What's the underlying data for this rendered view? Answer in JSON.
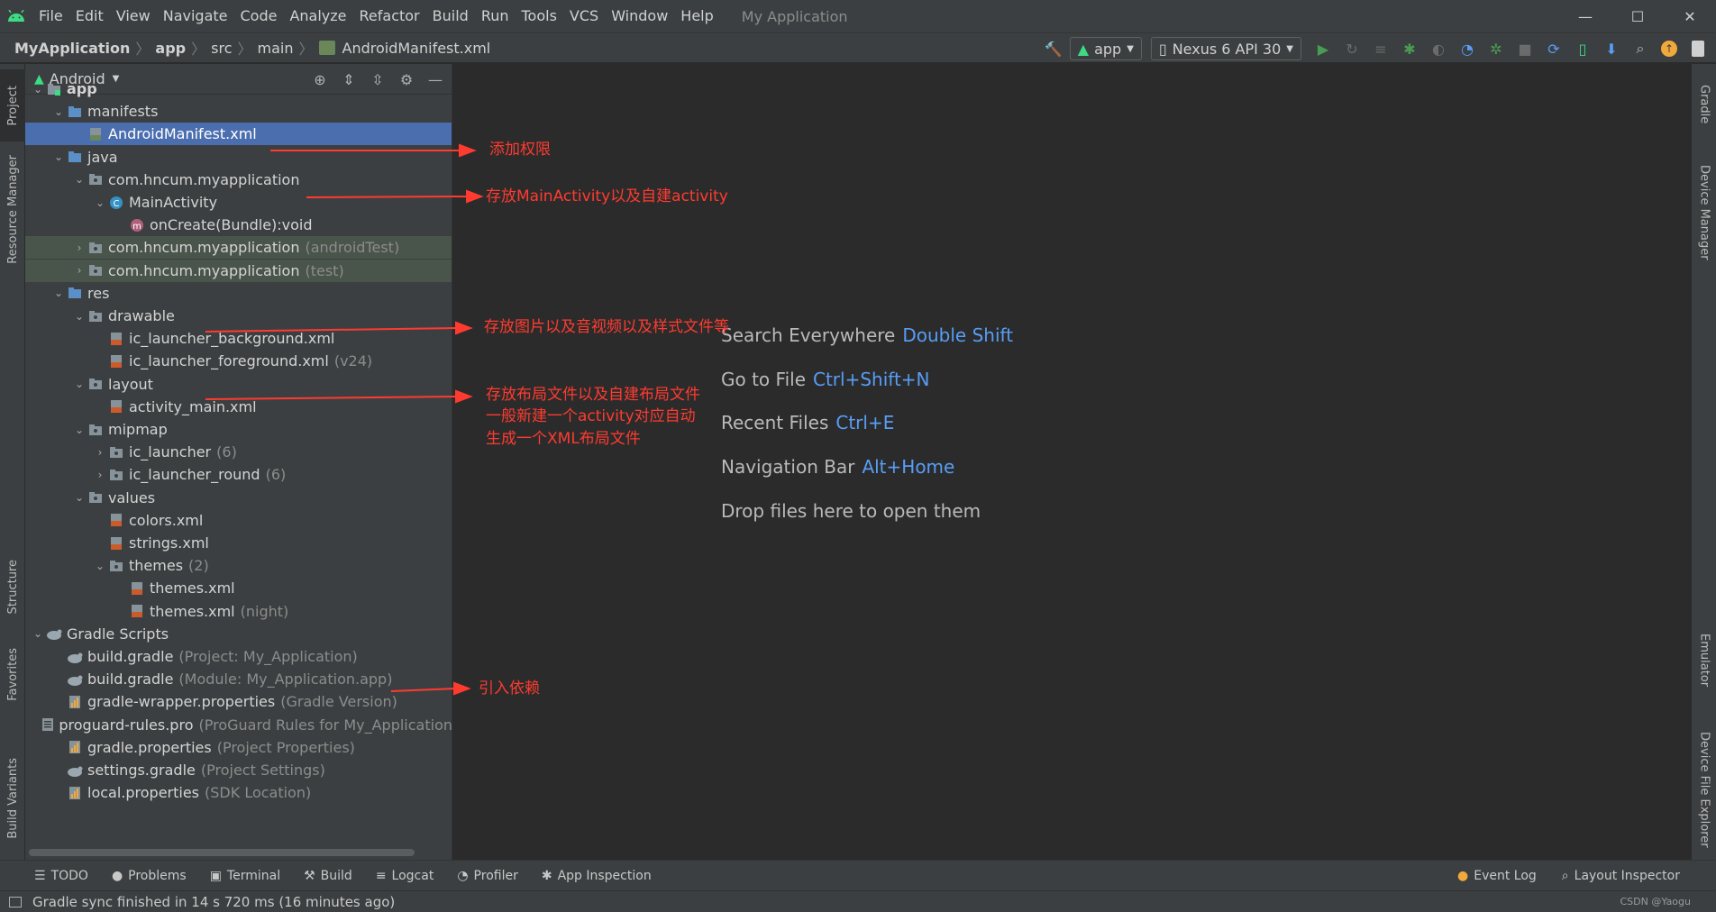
{
  "menu": {
    "items": [
      "File",
      "Edit",
      "View",
      "Navigate",
      "Code",
      "Analyze",
      "Refactor",
      "Build",
      "Run",
      "Tools",
      "VCS",
      "Window",
      "Help"
    ],
    "window_title": "My Application"
  },
  "window_controls": {
    "minimize": "—",
    "maximize": "☐",
    "close": "✕"
  },
  "breadcrumb": [
    "MyApplication",
    "app",
    "src",
    "main",
    "AndroidManifest.xml"
  ],
  "toolbar": {
    "config": "app",
    "device": "Nexus 6 API 30"
  },
  "project_panel": {
    "view": "Android"
  },
  "tree": [
    {
      "label": "app",
      "hint": ""
    },
    {
      "label": "manifests",
      "hint": ""
    },
    {
      "label": "AndroidManifest.xml",
      "hint": ""
    },
    {
      "label": "java",
      "hint": ""
    },
    {
      "label": "com.hncum.myapplication",
      "hint": ""
    },
    {
      "label": "MainActivity",
      "hint": ""
    },
    {
      "label": "onCreate(Bundle):void",
      "hint": ""
    },
    {
      "label": "com.hncum.myapplication",
      "hint": "(androidTest)"
    },
    {
      "label": "com.hncum.myapplication",
      "hint": "(test)"
    },
    {
      "label": "res",
      "hint": ""
    },
    {
      "label": "drawable",
      "hint": ""
    },
    {
      "label": "ic_launcher_background.xml",
      "hint": ""
    },
    {
      "label": "ic_launcher_foreground.xml",
      "hint": "(v24)"
    },
    {
      "label": "layout",
      "hint": ""
    },
    {
      "label": "activity_main.xml",
      "hint": ""
    },
    {
      "label": "mipmap",
      "hint": ""
    },
    {
      "label": "ic_launcher",
      "hint": "(6)"
    },
    {
      "label": "ic_launcher_round",
      "hint": "(6)"
    },
    {
      "label": "values",
      "hint": ""
    },
    {
      "label": "colors.xml",
      "hint": ""
    },
    {
      "label": "strings.xml",
      "hint": ""
    },
    {
      "label": "themes",
      "hint": "(2)"
    },
    {
      "label": "themes.xml",
      "hint": ""
    },
    {
      "label": "themes.xml",
      "hint": "(night)"
    },
    {
      "label": "Gradle Scripts",
      "hint": ""
    },
    {
      "label": "build.gradle",
      "hint": "(Project: My_Application)"
    },
    {
      "label": "build.gradle",
      "hint": "(Module: My_Application.app)"
    },
    {
      "label": "gradle-wrapper.properties",
      "hint": "(Gradle Version)"
    },
    {
      "label": "proguard-rules.pro",
      "hint": "(ProGuard Rules for My_Application"
    },
    {
      "label": "gradle.properties",
      "hint": "(Project Properties)"
    },
    {
      "label": "settings.gradle",
      "hint": "(Project Settings)"
    },
    {
      "label": "local.properties",
      "hint": "(SDK Location)"
    }
  ],
  "editor_hints": [
    {
      "text": "Search Everywhere",
      "key": "Double Shift"
    },
    {
      "text": "Go to File",
      "key": "Ctrl+Shift+N"
    },
    {
      "text": "Recent Files",
      "key": "Ctrl+E"
    },
    {
      "text": "Navigation Bar",
      "key": "Alt+Home"
    },
    {
      "text": "Drop files here to open them",
      "key": ""
    }
  ],
  "annotations": [
    "添加权限",
    "存放MainActivity以及自建activity",
    "存放图片以及音视频以及样式文件等",
    "存放布局文件以及自建布局文件",
    "一般新建一个activity对应自动",
    "生成一个XML布局文件",
    "引入依赖"
  ],
  "left_stripe": [
    "Project",
    "Resource Manager",
    "Structure",
    "Favorites",
    "Build Variants"
  ],
  "right_stripe": [
    "Gradle",
    "Device Manager",
    "Emulator",
    "Device File Explorer"
  ],
  "tool_windows": [
    "TODO",
    "Problems",
    "Terminal",
    "Build",
    "Logcat",
    "Profiler",
    "App Inspection"
  ],
  "tool_windows_right": [
    "Event Log",
    "Layout Inspector"
  ],
  "status": {
    "message": "Gradle sync finished in 14 s 720 ms (16 minutes ago)",
    "watermark": "CSDN @Yaogu"
  },
  "colors": {
    "accent": "#4b6eaf",
    "annotation": "#ff3b30",
    "key": "#589df6",
    "android": "#3ddc84"
  }
}
